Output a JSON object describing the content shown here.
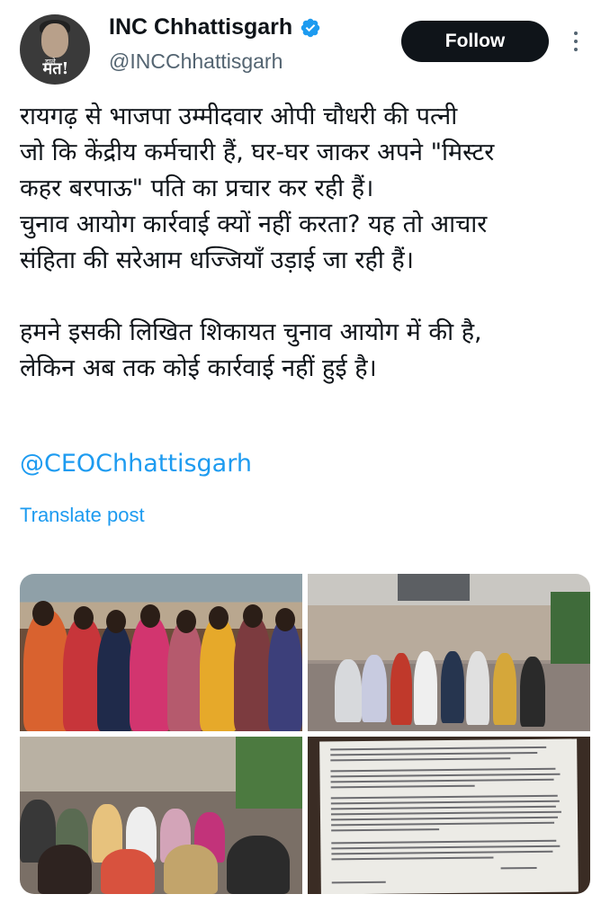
{
  "author": {
    "display_name": "INC Chhattisgarh",
    "handle": "@INCChhattisgarh",
    "avatar_badge": "मत!",
    "avatar_badge_small": "डाले",
    "verified": true
  },
  "actions": {
    "follow_label": "Follow"
  },
  "tweet": {
    "lines": [
      "रायगढ़ से भाजपा उम्मीदवार ओपी चौधरी की पत्नी",
      "जो कि केंद्रीय कर्मचारी हैं, घर-घर जाकर अपने \"मिस्टर",
      "कहर बरपाऊ\" पति का प्रचार कर रही हैं।",
      "चुनाव आयोग कार्रवाई क्यों नहीं करता? यह तो आचार",
      "संहिता की सरेआम धज्जियाँ उड़ाई जा रही हैं।",
      "",
      "हमने इसकी लिखित शिकायत चुनाव आयोग में की है,",
      "लेकिन अब तक कोई कार्रवाई नहीं हुई है।"
    ],
    "mention": "@CEOChhattisgarh",
    "translate_label": "Translate post"
  },
  "colors": {
    "link": "#1d9bf0",
    "text": "#0f1419",
    "secondary": "#536471",
    "follow_bg": "#0f1419"
  },
  "media": {
    "photos": [
      "group-photo-women",
      "group-photo-courtyard",
      "group-photo-meeting",
      "complaint-letter-photo"
    ]
  }
}
